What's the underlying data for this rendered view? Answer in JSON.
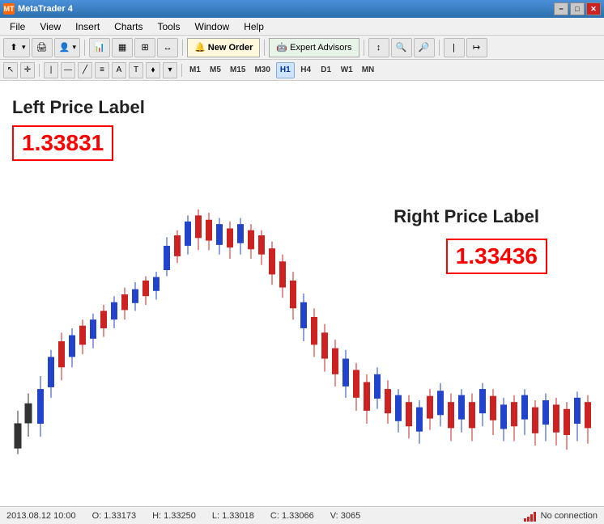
{
  "titleBar": {
    "title": "MetaTrader 4",
    "minimizeLabel": "−",
    "maximizeLabel": "□",
    "closeLabel": "✕"
  },
  "menuBar": {
    "items": [
      "File",
      "View",
      "Insert",
      "Charts",
      "Tools",
      "Window",
      "Help"
    ]
  },
  "toolbar": {
    "newOrderLabel": "New Order",
    "expertAdvisorsLabel": "Expert Advisors"
  },
  "toolsBar": {
    "timeframes": [
      "M1",
      "M5",
      "M15",
      "M30",
      "H1",
      "H4",
      "D1",
      "W1",
      "MN"
    ],
    "activeTimeframe": "H1"
  },
  "chart": {
    "leftLabel": "Left Price Label",
    "leftPrice": "1.33831",
    "rightLabel": "Right Price Label",
    "rightPrice": "1.33436"
  },
  "statusBar": {
    "datetime": "2013.08.12 10:00",
    "open": "O: 1.33173",
    "high": "H: 1.33250",
    "low": "L: 1.33018",
    "close": "C: 1.33066",
    "volume": "V: 3065",
    "noConnection": "No connection"
  }
}
